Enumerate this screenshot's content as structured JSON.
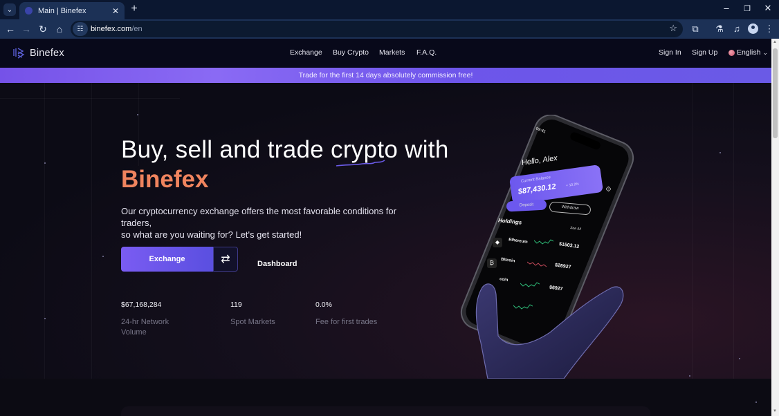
{
  "browser": {
    "tab_title": "Main | Binefex",
    "url_host": "binefex.com",
    "url_path": "/en",
    "icons": {
      "tab_menu": "chevron-down-icon",
      "tab_close": "close-icon",
      "new_tab": "plus-icon",
      "minimize": "minimize-icon",
      "restore": "restore-icon",
      "close_window": "close-icon",
      "back": "arrow-left-icon",
      "forward": "arrow-right-icon",
      "reload": "reload-icon",
      "home": "home-icon",
      "site_info": "tune-icon",
      "bookmark": "star-icon",
      "extensions": "puzzle-icon",
      "labs": "flask-icon",
      "media": "playlist-icon",
      "profile": "avatar-icon",
      "menu": "kebab-menu-icon"
    },
    "glyphs": {
      "tab_menu": "⌄",
      "tab_close": "✕",
      "new_tab": "+",
      "minimize": "–",
      "restore": "❐",
      "close_window": "✕",
      "back": "←",
      "forward": "→",
      "reload": "↻",
      "home": "⌂",
      "site_info": "☷",
      "bookmark": "☆",
      "extensions": "⧉",
      "labs": "⚗",
      "media": "♫",
      "menu": "⋮"
    }
  },
  "site": {
    "brand": "Binefex",
    "nav": [
      {
        "label": "Exchange"
      },
      {
        "label": "Buy Crypto"
      },
      {
        "label": "Markets"
      },
      {
        "label": "F.A.Q."
      }
    ],
    "sign_in": "Sign In",
    "sign_up": "Sign Up",
    "language": "English",
    "language_chevron": "⌄"
  },
  "promo": {
    "text": "Trade for the first 14 days absolutely commission free!"
  },
  "hero": {
    "headline": "Buy, sell and trade crypto with",
    "headline_highlight": "Binefex",
    "description_line1": "Our cryptocurrency exchange offers the most favorable conditions for traders,",
    "description_line2": "so what are you waiting for? Let's get started!",
    "exchange_button": "Exchange",
    "swap_glyph": "⇄",
    "dashboard_button": "Dashboard",
    "stats": [
      {
        "value": "$67,168,284",
        "label": "24-hr Network Volume"
      },
      {
        "value": "119",
        "label": "Spot Markets"
      },
      {
        "value": "0.0%",
        "label": "Fee for first trades"
      }
    ]
  },
  "phone": {
    "time": "09:41",
    "greeting": "Hello, Alex",
    "balance_label": "Current Balance",
    "balance": "$87,430.12",
    "change": "+ 10.2%",
    "deposit": "Deposit",
    "withdraw": "Withdraw",
    "holdings_title": "Holdings",
    "see_all": "See All",
    "holdings": [
      {
        "name": "Ethereum",
        "symbol": "ETH",
        "value": "$1503.12",
        "trend": "up"
      },
      {
        "name": "Bitcoin",
        "symbol": "BTC",
        "value": "$26927",
        "trend": "down"
      },
      {
        "name": "coin",
        "symbol": "",
        "value": "$6927",
        "trend": "up"
      }
    ]
  },
  "colors": {
    "accent_purple": "#7552e8",
    "brand_orange": "#f0845e",
    "background": "#0c0b15"
  }
}
